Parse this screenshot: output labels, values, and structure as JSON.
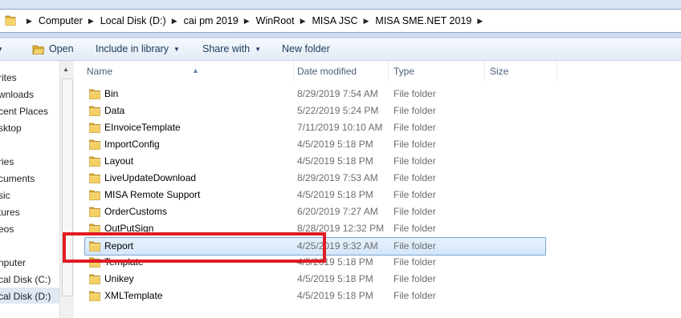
{
  "address_bar": {
    "crumbs": [
      "Computer",
      "Local Disk (D:)",
      "cai pm 2019",
      "WinRoot",
      "MISA JSC",
      "MISA SME.NET 2019"
    ]
  },
  "toolbar": {
    "open_label": "Open",
    "include_label": "Include in library",
    "share_label": "Share with",
    "new_folder_label": "New folder"
  },
  "nav": {
    "items": [
      "rites",
      "wnloads",
      "cent Places",
      "sktop",
      "ries",
      "cuments",
      "sic",
      "tures",
      "eos",
      "nputer",
      "cal Disk (C:)",
      "cal Disk (D:)"
    ]
  },
  "columns": {
    "name": "Name",
    "date": "Date modified",
    "type": "Type",
    "size": "Size"
  },
  "files": [
    {
      "name": "Bin",
      "date": "8/29/2019 7:54 AM",
      "type": "File folder"
    },
    {
      "name": "Data",
      "date": "5/22/2019 5:24 PM",
      "type": "File folder"
    },
    {
      "name": "EInvoiceTemplate",
      "date": "7/11/2019 10:10 AM",
      "type": "File folder"
    },
    {
      "name": "ImportConfig",
      "date": "4/5/2019 5:18 PM",
      "type": "File folder"
    },
    {
      "name": "Layout",
      "date": "4/5/2019 5:18 PM",
      "type": "File folder"
    },
    {
      "name": "LiveUpdateDownload",
      "date": "8/29/2019 7:53 AM",
      "type": "File folder"
    },
    {
      "name": "MISA Remote Support",
      "date": "4/5/2019 5:18 PM",
      "type": "File folder"
    },
    {
      "name": "OrderCustoms",
      "date": "6/20/2019 7:27 AM",
      "type": "File folder"
    },
    {
      "name": "OutPutSign",
      "date": "8/28/2019 12:32 PM",
      "type": "File folder"
    },
    {
      "name": "Report",
      "date": "4/25/2019 9:32 AM",
      "type": "File folder",
      "selected": true
    },
    {
      "name": "Template",
      "date": "4/5/2019 5:18 PM",
      "type": "File folder"
    },
    {
      "name": "Unikey",
      "date": "4/5/2019 5:18 PM",
      "type": "File folder"
    },
    {
      "name": "XMLTemplate",
      "date": "4/5/2019 5:18 PM",
      "type": "File folder"
    }
  ],
  "colors": {
    "highlight_box": "#e01b24",
    "selection": "#d3e6fb",
    "folder": "#e8b938"
  }
}
